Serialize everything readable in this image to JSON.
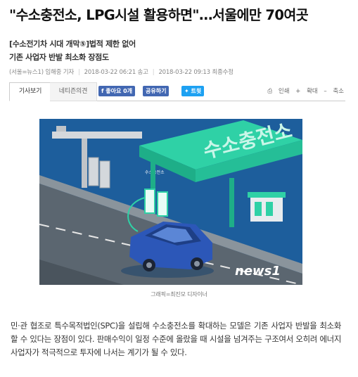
{
  "article": {
    "headline": "\"수소충전소, LPG시설 활용하면\"…서울에만 70여곳",
    "subtitle1": "[수소전기차 시대 개막⑤]법적 제한 없어",
    "subtitle2": "기존 사업자 반발 최소화 장점도",
    "byline": "(서울=뉴스1) 임해중 기자",
    "published": "2018-03-22 06:21 송고",
    "updated": "2018-03-22 09:13 최종수정",
    "image_caption": "그래픽=최진모 디자이너",
    "body": "민·관 협조로 특수목적법인(SPC)을 설립해 수소충전소를 확대하는 모델은 기존 사업자 반발을 최소화할 수 있다는 장점이 있다. 판매수익이 일정 수준에 올랐을 때 시설을 넘겨주는 구조여서 오히려 에너지 사업자가 적극적으로 투자에 나서는 계기가 될 수 있다."
  },
  "tabs": {
    "article_tab": "기사보기",
    "comments_tab": "네티즌의견"
  },
  "social": {
    "like_label": "좋아요 0개",
    "share_label": "공유하기",
    "tweet_label": "트윗"
  },
  "tools": {
    "print_label": "인쇄",
    "zoom_in_label": "확대",
    "zoom_out_label": "축소"
  },
  "illustration": {
    "canopy_text": "수소충전소",
    "station_sign": "수소충전소",
    "watermark": "news1"
  },
  "colors": {
    "figure_bg": "#1d5e9c",
    "canopy_green": "#2fd1a6",
    "road": "#5b6670",
    "car": "#2c57b8",
    "facebook": "#4267b2",
    "twitter": "#1da1f2"
  }
}
